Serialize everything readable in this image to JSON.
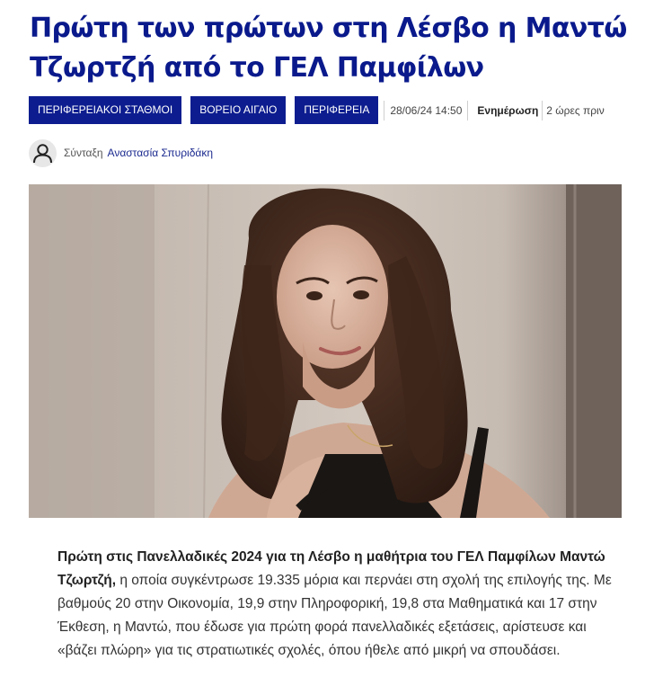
{
  "article": {
    "title": "Πρώτη των πρώτων στη Λέσβο η Μαντώ Τζωρτζή από το ΓΕΛ Παμφίλων",
    "tags": [
      {
        "label": "ΠΕΡΙΦΕΡΕΙΑΚΟΙ ΣΤΑΘΜΟΙ"
      },
      {
        "label": "ΒΟΡΕΙΟ ΑΙΓΑΙΟ"
      },
      {
        "label": "ΠΕΡΙΦΕΡΕΙΑ"
      }
    ],
    "date": "28/06/24 14:50",
    "updated_label": "Ενημέρωση",
    "updated_ago": "2 ώρες πριν",
    "author_label": "Σύνταξη",
    "author_name": "Αναστασία Σπυριδάκη",
    "body_bold": "Πρώτη στις Πανελλαδικές 2024 για τη Λέσβο η μαθήτρια του ΓΕΛ Παμφίλων Μαντώ Τζωρτζή,",
    "body_text": " η οποία συγκέντρωσε 19.335 μόρια και περνάει στη σχολή της επιλογής της. Με βαθμούς 20 στην Οικονομία, 19,9 στην Πληροφορική, 19,8 στα Μαθηματικά και 17 στην Έκθεση, η Μαντώ, που έδωσε για πρώτη φορά πανελλαδικές εξετάσεις, αρίστευσε και «βάζει πλώρη» για τις στρατιωτικές σχολές, όπου ήθελε από μικρή να σπουδάσει."
  },
  "icons": {
    "avatar": "user-icon"
  },
  "colors": {
    "title": "#0a1a8c",
    "tag_background": "#0d1d8f",
    "author_link": "#1b2a8f"
  }
}
